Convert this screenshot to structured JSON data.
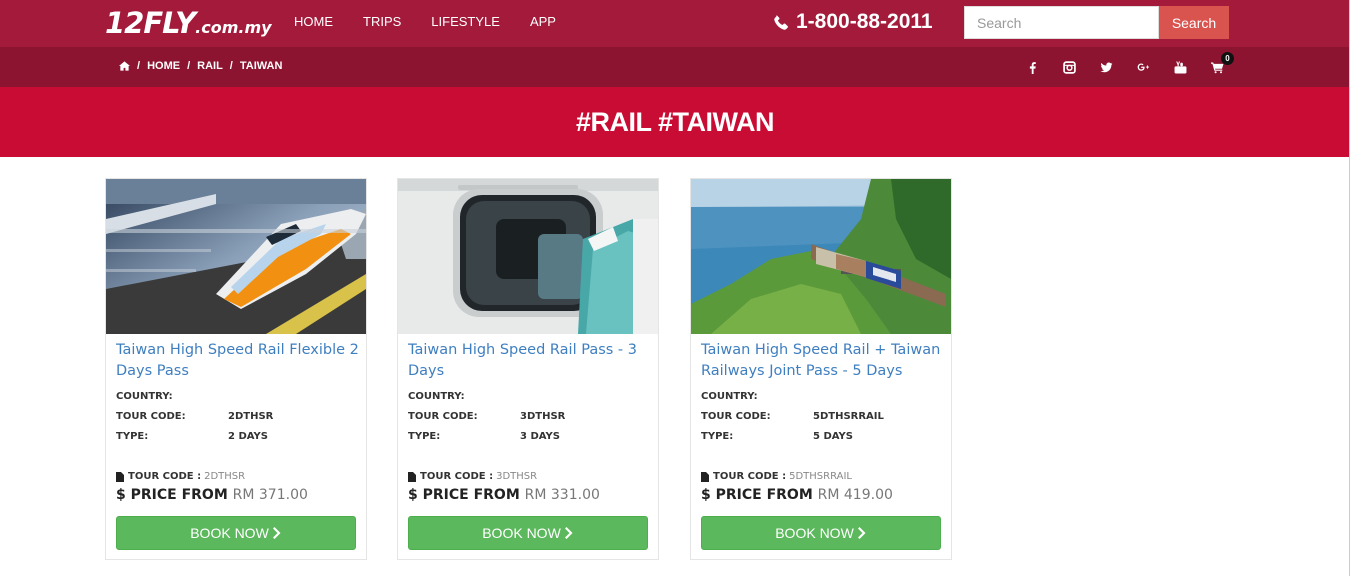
{
  "header": {
    "logo_big": "12FLY",
    "logo_small": ".com.my",
    "nav": [
      "HOME",
      "TRIPS",
      "LIFESTYLE",
      "APP"
    ],
    "phone": "1-800-88-2011",
    "search_placeholder": "Search",
    "search_button": "Search"
  },
  "breadcrumb": {
    "items": [
      "HOME",
      "RAIL",
      "TAIWAN"
    ],
    "separator": "/"
  },
  "cart_count": "0",
  "banner_title": "#RAIL #TAIWAN",
  "labels": {
    "country": "COUNTRY:",
    "tour_code": "TOUR CODE:",
    "type": "TYPE:",
    "tour_code_footer": "TOUR CODE :",
    "price_from": "$ PRICE FROM",
    "book_now": "BOOK NOW"
  },
  "cards": [
    {
      "title": "Taiwan High Speed Rail Flexible 2 Days Pass",
      "country": "",
      "tour_code": "2DTHSR",
      "type": "2 DAYS",
      "price": "RM 371.00"
    },
    {
      "title": "Taiwan High Speed Rail Pass - 3 Days",
      "country": "",
      "tour_code": "3DTHSR",
      "type": "3 DAYS",
      "price": "RM 331.00"
    },
    {
      "title": "Taiwan High Speed Rail + Taiwan Railways Joint Pass - 5 Days",
      "country": "",
      "tour_code": "5DTHSRRAIL",
      "type": "5 DAYS",
      "price": "RM 419.00"
    }
  ],
  "colors": {
    "topbar": "#a31a3b",
    "subbar": "#8c1430",
    "banner": "#c90c34",
    "search_button": "#d9534f",
    "book_button": "#5cb85c",
    "link": "#3f7fc0"
  },
  "icons": [
    "phone-icon",
    "home-icon",
    "facebook-icon",
    "instagram-icon",
    "twitter-icon",
    "google-plus-icon",
    "youtube-icon",
    "cart-icon",
    "document-icon",
    "chevron-right-icon"
  ]
}
